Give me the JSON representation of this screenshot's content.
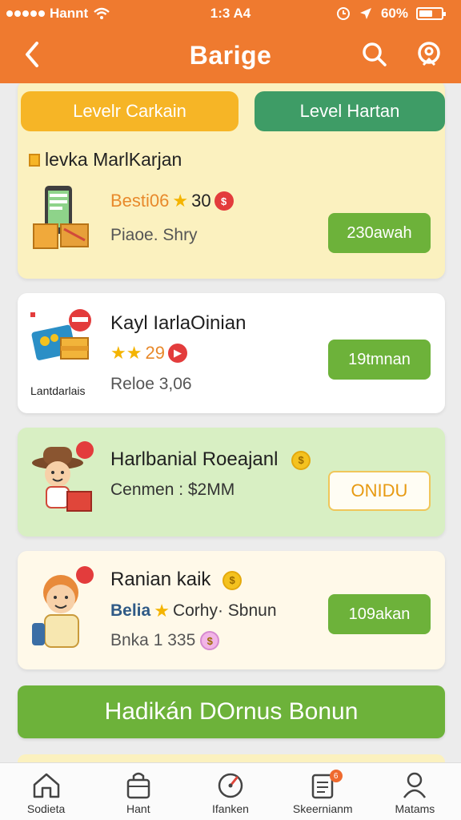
{
  "status_bar": {
    "carrier": "Hannt",
    "time": "1:3 A4",
    "battery_percent": "60%",
    "battery_level": 0.6
  },
  "header": {
    "title": "Barige",
    "back_icon": "chevron-left-icon",
    "search_icon": "search-icon",
    "profile_icon": "profile-icon"
  },
  "tabs": [
    {
      "label": "Levelr Carkain",
      "active": true
    },
    {
      "label": "Level Hartan",
      "active": false
    }
  ],
  "section": {
    "title": "levka MarlKarjan"
  },
  "items": [
    {
      "name": "",
      "price_label": "Besti06",
      "price_value": "30",
      "rating_stars": 1,
      "subtitle": "Piaoe. Shry",
      "button": "230awah"
    },
    {
      "name": "Kayl IarlaOinian",
      "rating_text": "29",
      "rating_stars": 2,
      "subtitle": "Reloe 3,06",
      "image_caption": "Lantdarlais",
      "button": "19tmnan"
    },
    {
      "name": "Harlbanial Roeajanl",
      "subtitle": "Cenmen : $2MM",
      "button": "ONIDU"
    },
    {
      "name": "Ranian kaik",
      "meta_brand": "Belia",
      "meta_text": "Corhy· Sbnun",
      "rating_stars": 1,
      "subtitle": "Bnka 1 335",
      "button": "109akan"
    }
  ],
  "bonus_button": "Hadikán DOrnus Bonun",
  "bottom_nav": [
    {
      "label": "Sodieta",
      "icon": "home-icon"
    },
    {
      "label": "Hant",
      "icon": "bag-icon"
    },
    {
      "label": "Ifanken",
      "icon": "gauge-icon"
    },
    {
      "label": "Skeernianm",
      "icon": "notes-icon",
      "badge": "6"
    },
    {
      "label": "Matams",
      "icon": "person-icon"
    }
  ],
  "colors": {
    "brand_orange": "#ef7a2f",
    "accent_green": "#6db23a",
    "tab_yellow": "#f6b526",
    "tab_green": "#3e9c66"
  }
}
